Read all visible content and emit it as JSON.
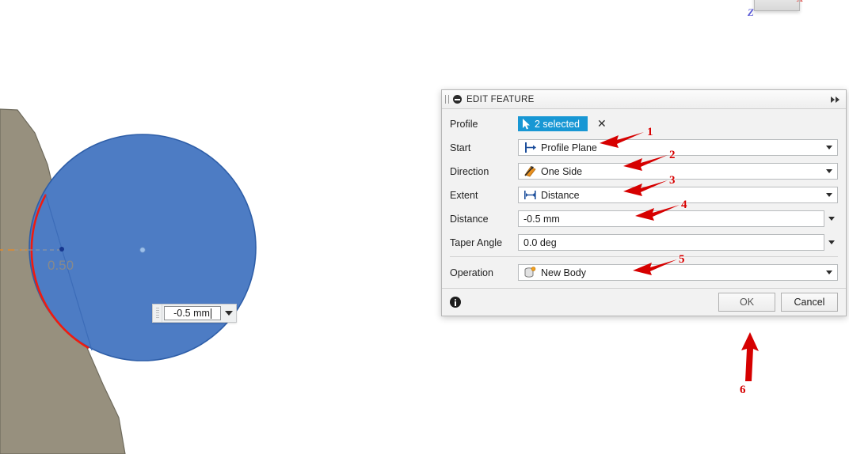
{
  "viewcube": {
    "axis_z_label": "Z",
    "axis_x_label": "X"
  },
  "canvas": {
    "dimension_label": "0.50",
    "inline_input": {
      "value": "-0.5 mm",
      "dropdown_icon": "chevron-down-icon",
      "grip_icon": "drag-grip-icon"
    },
    "colors": {
      "sketch_fill": "#4d7cc4",
      "sketch_outline": "#2e5ea8",
      "body_fill": "#97907e",
      "body_outline": "#6e6a5c",
      "highlight_edge": "#f01b0f",
      "construction_line": "#e08a2e",
      "dimension_text": "#8a8a8a"
    }
  },
  "dialog": {
    "title": "EDIT FEATURE",
    "collapse_icon": "collapse-circle-icon",
    "grip_icon": "dialog-grip-icon",
    "expand_icon": "double-chevron-right-icon",
    "rows": [
      {
        "label": "Profile",
        "type": "selection",
        "badge_text": "2 selected",
        "badge_icon": "cursor-arrow-icon",
        "clear_label": "✕"
      },
      {
        "label": "Start",
        "type": "dropdown",
        "value": "Profile Plane",
        "icon": "profile-plane-icon"
      },
      {
        "label": "Direction",
        "type": "dropdown",
        "value": "One Side",
        "icon": "one-side-icon"
      },
      {
        "label": "Extent",
        "type": "dropdown",
        "value": "Distance",
        "icon": "distance-icon"
      },
      {
        "label": "Distance",
        "type": "field",
        "value": "-0.5 mm",
        "icon": ""
      },
      {
        "label": "Taper Angle",
        "type": "field",
        "value": "0.0 deg",
        "icon": ""
      },
      {
        "label": "Operation",
        "type": "dropdown",
        "value": "New Body",
        "icon": "new-body-icon"
      }
    ],
    "footer": {
      "info_icon": "info-icon",
      "ok_label": "OK",
      "cancel_label": "Cancel"
    }
  },
  "annotations": {
    "color": "#d60000",
    "markers": [
      {
        "number": "1",
        "target": "start-row"
      },
      {
        "number": "2",
        "target": "direction-row"
      },
      {
        "number": "3",
        "target": "extent-row"
      },
      {
        "number": "4",
        "target": "distance-row"
      },
      {
        "number": "5",
        "target": "operation-row"
      },
      {
        "number": "6",
        "target": "ok-button"
      }
    ]
  }
}
